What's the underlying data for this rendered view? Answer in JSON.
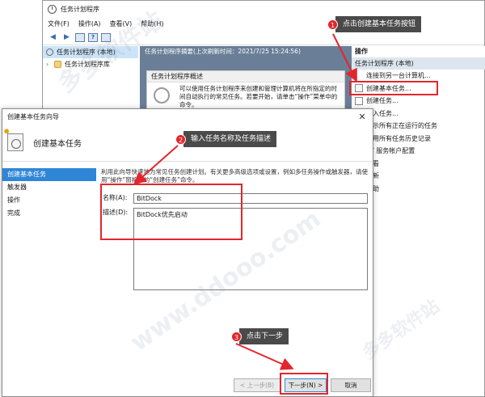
{
  "main_window": {
    "title": "任务计划程序",
    "menu": [
      "文件(F)",
      "操作(A)",
      "查看(V)",
      "帮助(H)"
    ],
    "toolbar": {
      "help_glyph": "?"
    },
    "tree": [
      "任务计划程序 (本地)",
      "任务计划程序库"
    ],
    "summary_header": "任务计划程序摘要(上次刷新时间：2021/7/25 15:24:56)",
    "overview_title": "任务计划程序概述",
    "overview_text": "可以使用任务计划程序来创建和管理计算机将在所指定的时间自动执行的常见任务。若要开始，请单击“操作”菜单中的命令。",
    "actions_title": "操作",
    "actions_section": "任务计划程序 (本地)",
    "actions": [
      "连接到另一台计算机...",
      "创建基本任务...",
      "创建任务...",
      "导入任务...",
      "显示所有正在运行的任务",
      "启用所有任务历史记录",
      "AT 服务帐户配置",
      "查看",
      "刷新",
      "帮助"
    ]
  },
  "wizard": {
    "title": "创建基本任务向导",
    "heading": "创建基本任务",
    "steps": [
      "创建基本任务",
      "触发器",
      "操作",
      "完成"
    ],
    "intro": "利用此向导快速地为常见任务创建计划。有关更多高级选项或设置，例如多任务操作或触发器，请使用“操作”窗格中的“创建任务”命令。",
    "name_label": "名称(A):",
    "name_value": "BitDock",
    "desc_label": "描述(D):",
    "desc_value": "BitDock优先启动",
    "back": "< 上一步(B)",
    "next": "下一步(N) >",
    "cancel": "取消"
  },
  "callouts": [
    {
      "num": "1",
      "text": "点击创建基本任务按钮"
    },
    {
      "num": "2",
      "text": "输入任务名称及任务描述"
    },
    {
      "num": "3",
      "text": "点击下一步"
    }
  ],
  "watermarks": [
    "多多软件站",
    "www.ddooo.com"
  ],
  "colors": {
    "accent": "#2f86d6",
    "callout_red": "#e3262c",
    "callout_bg": "#4a4a4a"
  }
}
